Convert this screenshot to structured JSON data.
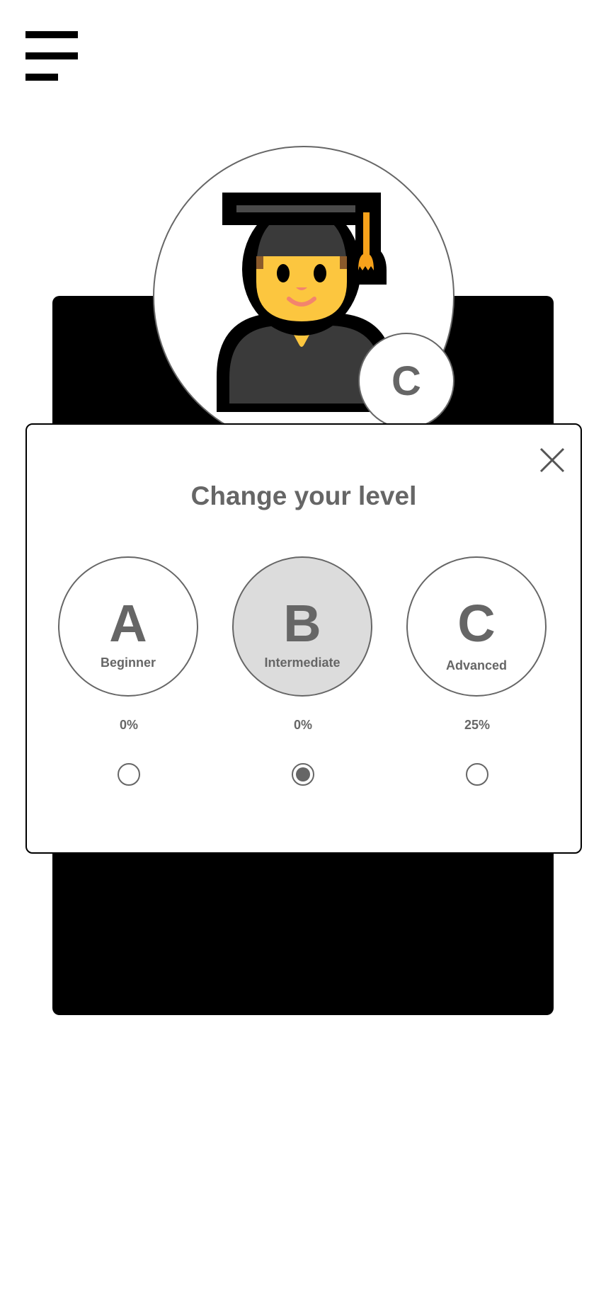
{
  "menu": {
    "icon": "hamburger-menu-icon"
  },
  "profile": {
    "avatar_icon": "student-graduate-icon",
    "level_badge": "C"
  },
  "modal": {
    "title": "Change your level",
    "close_icon": "close-icon",
    "levels": [
      {
        "letter": "A",
        "name": "Beginner",
        "progress": "0%",
        "selected": false
      },
      {
        "letter": "B",
        "name": "Intermediate",
        "progress": "0%",
        "selected": true
      },
      {
        "letter": "C",
        "name": "Advanced",
        "progress": "25%",
        "selected": false
      }
    ]
  },
  "colors": {
    "text_gray": "#666666",
    "selected_bg": "#dcdcdc",
    "card_bg": "#000000"
  }
}
